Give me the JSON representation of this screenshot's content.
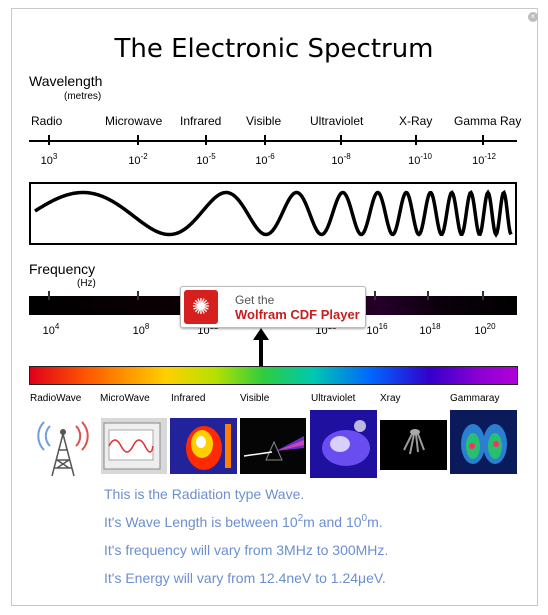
{
  "title": "The Electronic Spectrum",
  "wavelength": {
    "label": "Wavelength",
    "unit": "(metres)",
    "bands": [
      "Radio",
      "Microwave",
      "Infrared",
      "Visible",
      "Ultraviolet",
      "X-Ray",
      "Gamma Ray"
    ],
    "ticks": [
      {
        "base": "10",
        "exp": "3"
      },
      {
        "base": "10",
        "exp": "-2"
      },
      {
        "base": "10",
        "exp": "-5"
      },
      {
        "base": "10",
        "exp": "-6"
      },
      {
        "base": "10",
        "exp": "-8"
      },
      {
        "base": "10",
        "exp": "-10"
      },
      {
        "base": "10",
        "exp": "-12"
      }
    ]
  },
  "frequency": {
    "label": "Frequency",
    "unit": "(Hz)",
    "ticks": [
      {
        "base": "10",
        "exp": "4"
      },
      {
        "base": "10",
        "exp": "8"
      },
      {
        "base": "10",
        "exp": "12"
      },
      {
        "base": "10",
        "exp": "15"
      },
      {
        "base": "10",
        "exp": "16"
      },
      {
        "base": "10",
        "exp": "18"
      },
      {
        "base": "10",
        "exp": "20"
      }
    ]
  },
  "cdf_prompt": {
    "line1": "Get the",
    "line2": "Wolfram CDF Player",
    "logo_icon": "wolfram-spikey-icon",
    "color": "#c81e1e"
  },
  "radiation_types": [
    "RadioWave",
    "MicroWave",
    "Infrared",
    "Visible",
    "Ultraviolet",
    "Xray",
    "Gammaray"
  ],
  "info": {
    "line1": "This is the Radiation type Wave.",
    "line2_prefix": "It's Wave Length is between 10",
    "line2_exp1": "2",
    "line2_mid": "m and 10",
    "line2_exp2": "0",
    "line2_suffix": "m.",
    "line3": "It's frequency will vary from 3MHz to 300MHz.",
    "line4": "It's Energy will vary from 12.4neV to 1.24μeV.",
    "color": "#6b8fd0"
  }
}
